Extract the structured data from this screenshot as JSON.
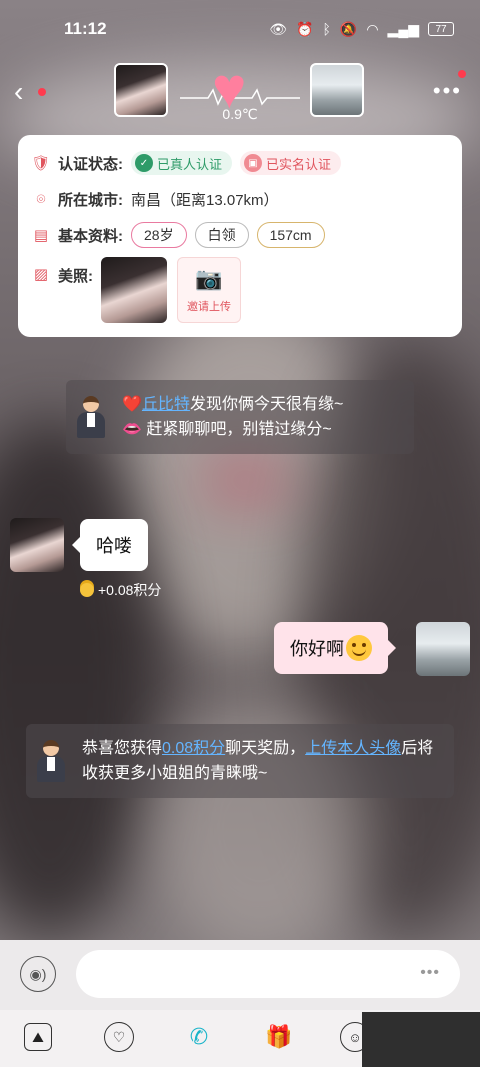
{
  "status_bar": {
    "time": "11:12",
    "icons": [
      "eye-icon",
      "alarm-icon",
      "bluetooth-icon",
      "mute-icon",
      "wifi-icon",
      "signal-icon"
    ],
    "battery": "77"
  },
  "header": {
    "temperature": "0.9℃",
    "accent_color": "#ff7f9e",
    "notification_color": "#ff3b4e"
  },
  "profile_card": {
    "verification_label": "认证状态:",
    "real_person_badge": "已真人认证",
    "real_name_badge": "已实名认证",
    "city_label": "所在城市:",
    "city_value": "南昌（距离13.07km）",
    "basic_info_label": "基本资料:",
    "tags": [
      "28岁",
      "白领",
      "157cm"
    ],
    "photos_label": "美照:",
    "upload_label": "邀请上传"
  },
  "system_message_1": {
    "line1_prefix": "❤️",
    "line1_link": "丘比特",
    "line1_suffix": "发现你俩今天很有缘~",
    "line2": "👄 赶紧聊聊吧，别错过缘分~"
  },
  "messages": [
    {
      "sender": "other",
      "text": "哈喽",
      "points": "+0.08积分"
    },
    {
      "sender": "self",
      "text": "你好啊",
      "emoji": "smiling-face-emoji"
    }
  ],
  "system_message_2": {
    "text_prefix": "恭喜您获得",
    "points_link": "0.08积分",
    "text_middle": "聊天奖励，",
    "upload_link": "上传本人头像",
    "text_suffix": "后将收获更多小姐姐的青睐哦~",
    "link_color": "#64b5ff"
  },
  "input_bar": {
    "placeholder": "",
    "more_label": "•••"
  },
  "toolbar": {
    "items": [
      "image-icon",
      "like-icon",
      "video-call-icon",
      "gift-icon",
      "emoji-icon"
    ]
  }
}
